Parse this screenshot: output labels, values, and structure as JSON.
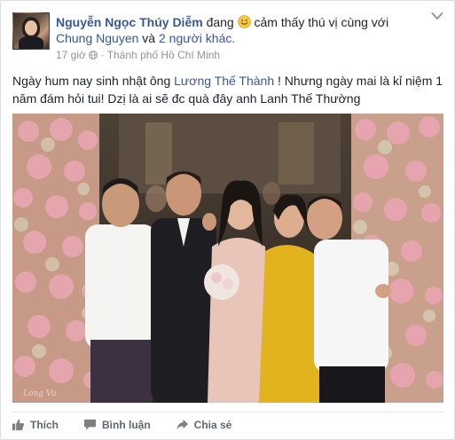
{
  "post": {
    "author": "Nguyễn Ngọc Thúy Diễm",
    "feeling_prefix": "đang",
    "feeling_text": "cảm thấy thú vị cùng với",
    "tagged_person": "Chung Nguyen",
    "tagged_joiner": "và",
    "tagged_others": "2 người khác.",
    "time": "17 giờ",
    "location_separator": "·",
    "location": "Thành phố Hồ Chí Minh",
    "text_part1": "Ngày hum nay sinh nhật ông",
    "mention": "Lương Thế Thành",
    "text_part2": "! Nhưng ngày mai là kỉ niệm 1 năm đám hỏi tui! Dzị là ai sẽ đc quà đây anh Lanh Thế Thường",
    "photo_signature": "Long Vu"
  },
  "actions": {
    "like": "Thích",
    "comment": "Bình luận",
    "share": "Chia sẻ"
  },
  "icons": {
    "emoji": "smiling-face-icon",
    "globe": "globe-icon",
    "menu": "chevron-down-icon",
    "like": "thumbs-up-icon",
    "comment": "speech-bubble-icon",
    "share": "share-arrow-icon"
  },
  "colors": {
    "link": "#365899",
    "meta": "#90949c",
    "action": "#616770"
  }
}
